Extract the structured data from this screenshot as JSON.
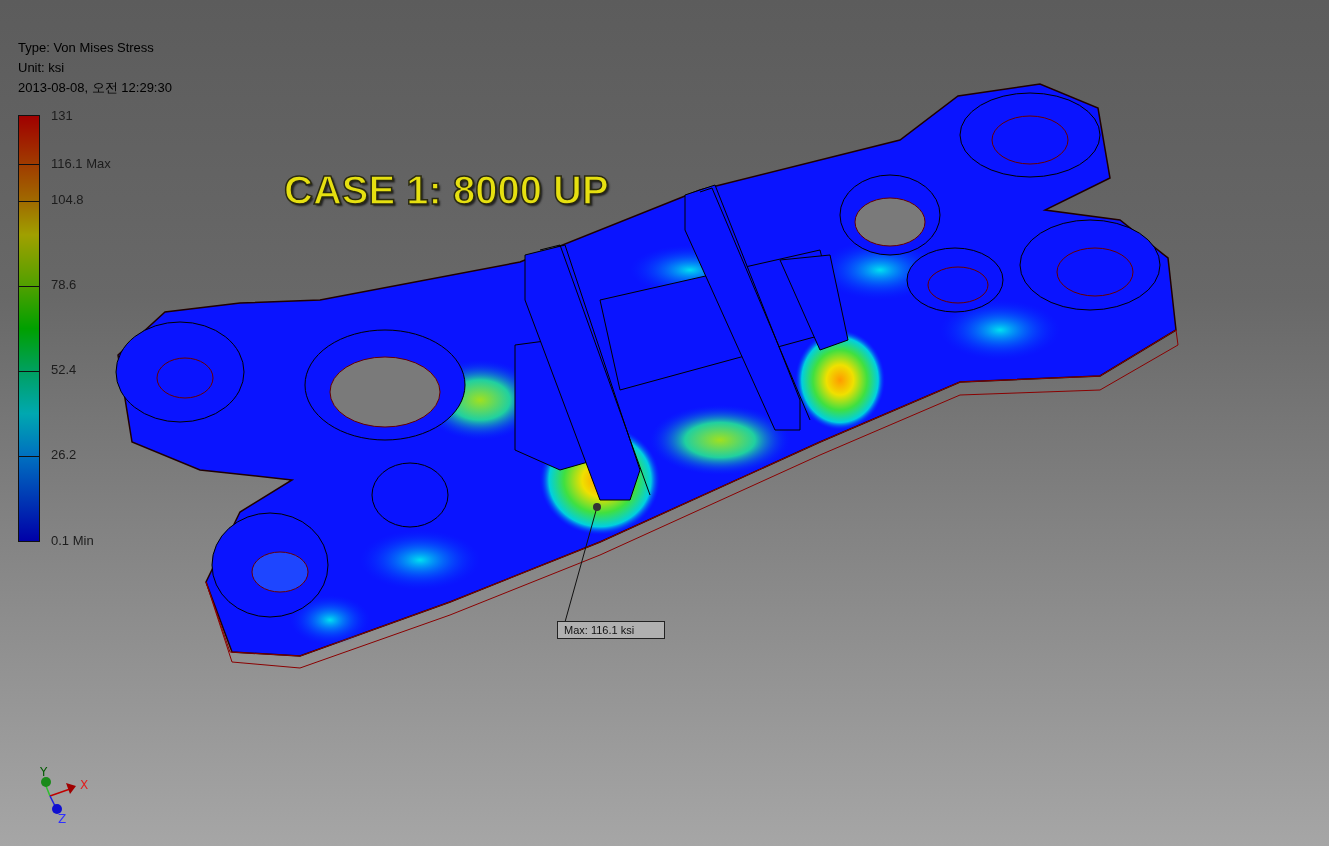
{
  "legend": {
    "type": "Type: Von Mises Stress",
    "unit": "Unit: ksi",
    "timestamp": "2013-08-08, 오전 12:29:30",
    "ticks": [
      "131",
      "116.1 Max",
      "104.8",
      "78.6",
      "52.4",
      "26.2",
      "0.1 Min"
    ]
  },
  "title": "CASE 1: 8000 UP",
  "probe": {
    "label": "Max: 116.1 ksi"
  },
  "axes": {
    "x": "X",
    "y": "Y",
    "z": "Z"
  }
}
